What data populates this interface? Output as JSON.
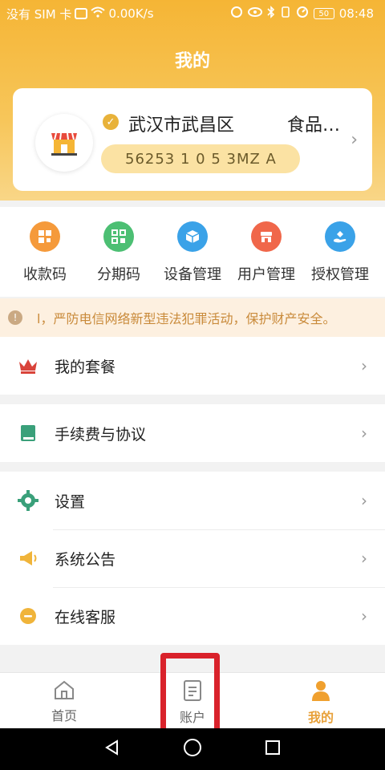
{
  "status_bar": {
    "carrier": "没有 SIM 卡",
    "network_speed": "0.00K/s",
    "battery": "50",
    "time": "08:48"
  },
  "header": {
    "title": "我的"
  },
  "merchant": {
    "name": "武汉市武昌区   食品…",
    "id": "56253 1 0 5  3MZ A"
  },
  "quick_actions": [
    {
      "label": "收款码",
      "icon": "qrcode-icon",
      "color": "#f59a3b"
    },
    {
      "label": "分期码",
      "icon": "grid-qrcode-icon",
      "color": "#4cbf73"
    },
    {
      "label": "设备管理",
      "icon": "cube-icon",
      "color": "#3aa2e8"
    },
    {
      "label": "用户管理",
      "icon": "store-user-icon",
      "color": "#f0674a"
    },
    {
      "label": "授权管理",
      "icon": "hand-authorize-icon",
      "color": "#3aa2e8"
    }
  ],
  "notice": {
    "text": "l，严防电信网络新型违法犯罪活动，保护财产安全。"
  },
  "menu": {
    "plan": {
      "label": "我的套餐",
      "icon": "crown-icon"
    },
    "fees": {
      "label": "手续费与协议",
      "icon": "book-icon"
    },
    "settings": {
      "label": "设置",
      "icon": "gear-icon"
    },
    "announcement": {
      "label": "系统公告",
      "icon": "megaphone-icon"
    },
    "service": {
      "label": "在线客服",
      "icon": "chat-icon"
    }
  },
  "tabs": [
    {
      "label": "首页",
      "icon": "home-icon"
    },
    {
      "label": "账户",
      "icon": "document-icon"
    },
    {
      "label": "我的",
      "icon": "person-icon"
    }
  ],
  "colors": {
    "accent": "#f5b535",
    "active_tab": "#e8a13a",
    "highlight": "#d9222b"
  }
}
